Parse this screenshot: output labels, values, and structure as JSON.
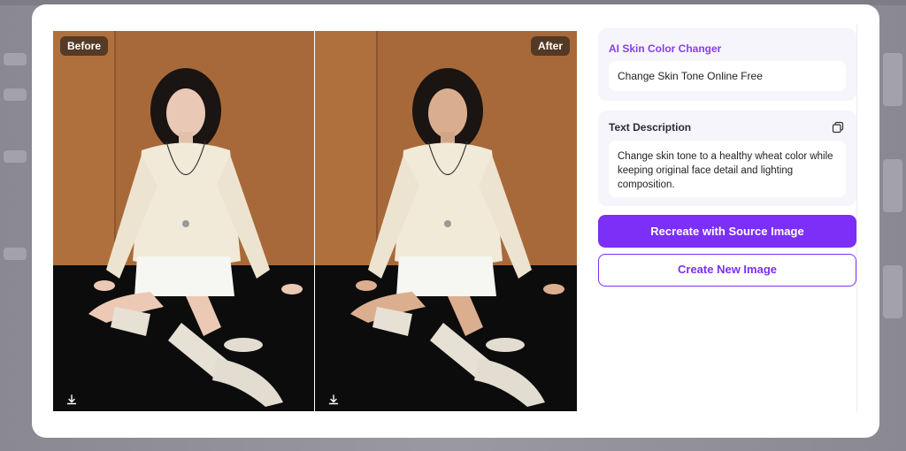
{
  "compare": {
    "before_label": "Before",
    "after_label": "After",
    "download_icon": "download-icon"
  },
  "panel": {
    "tool_title": "AI Skin Color Changer",
    "tool_value": "Change Skin Tone Online Free",
    "description_title": "Text Description",
    "description_text": "Change skin tone to a healthy wheat color while keeping original face detail and lighting composition.",
    "copy_icon": "copy-icon"
  },
  "buttons": {
    "recreate_label": "Recreate with Source Image",
    "create_new_label": "Create New Image"
  },
  "colors": {
    "accent": "#7b2ff7",
    "title_accent": "#8a3cf0",
    "card_bg": "#f5f5fb"
  }
}
